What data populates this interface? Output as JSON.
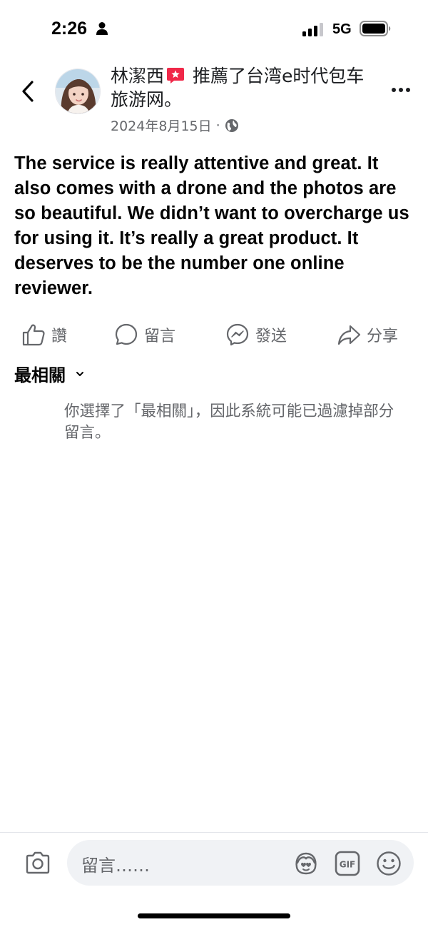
{
  "status_bar": {
    "time": "2:26",
    "network": "5G"
  },
  "header": {
    "author": "林潔西",
    "action_text": " 推薦了台湾e时代包车旅游网。",
    "date": "2024年8月15日",
    "separator": "·"
  },
  "post": {
    "text": "The service is really attentive and great. It also comes with a drone and the photos are so beautiful. We didn’t want to overcharge us for using it. It’s really a great product. It deserves to be the number one online reviewer."
  },
  "actions": {
    "like": "讚",
    "comment": "留言",
    "send": "發送",
    "share": "分享"
  },
  "comments": {
    "sort_label": "最相關",
    "notice": "你選擇了「最相關」，因此系統可能已過濾掉部分留言。"
  },
  "composer": {
    "placeholder": "留言……",
    "gif_label": "GIF"
  },
  "colors": {
    "text_primary": "#050505",
    "text_secondary": "#65676b",
    "composer_bg": "#f0f2f5",
    "badge": "#f02849"
  },
  "icons": [
    "back-arrow-icon",
    "more-icon",
    "globe-icon",
    "like-icon",
    "comment-icon",
    "messenger-icon",
    "share-icon",
    "camera-icon",
    "avatar-sticker-icon",
    "gif-icon",
    "emoji-icon"
  ]
}
